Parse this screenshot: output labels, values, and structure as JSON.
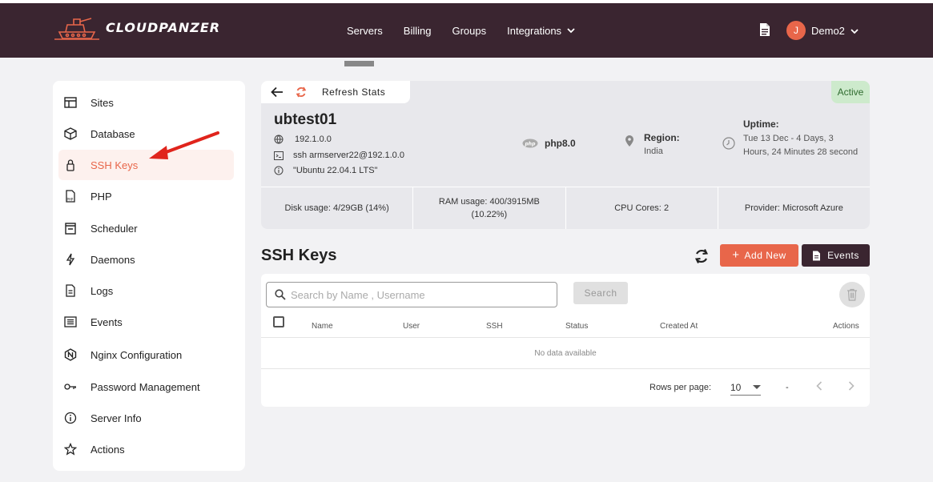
{
  "header": {
    "logo_text": "CLOUDPANZER",
    "nav": [
      {
        "label": "Servers"
      },
      {
        "label": "Billing"
      },
      {
        "label": "Groups"
      },
      {
        "label": "Integrations"
      }
    ],
    "avatar_initial": "J",
    "user_name": "Demo2",
    "colors": {
      "bg": "#3a2530",
      "accent": "#e8664a"
    }
  },
  "sidebar": {
    "items": [
      {
        "label": "Sites",
        "icon": "layout-icon"
      },
      {
        "label": "Database",
        "icon": "cube-icon"
      },
      {
        "label": "SSH Keys",
        "icon": "lock-icon",
        "active": true
      },
      {
        "label": "PHP",
        "icon": "php-file-icon"
      },
      {
        "label": "Scheduler",
        "icon": "calendar-icon"
      },
      {
        "label": "Daemons",
        "icon": "bolt-icon"
      },
      {
        "label": "Logs",
        "icon": "file-icon"
      },
      {
        "label": "Events",
        "icon": "list-icon"
      },
      {
        "label": "Nginx Configuration",
        "icon": "nginx-icon"
      },
      {
        "label": "Password Management",
        "icon": "key-icon"
      },
      {
        "label": "Server Info",
        "icon": "info-icon"
      },
      {
        "label": "Actions",
        "icon": "star-icon"
      }
    ]
  },
  "server": {
    "refresh_label": "Refresh Stats",
    "status": "Active",
    "name": "ubtest01",
    "ip": "192.1.0.0",
    "ssh": "ssh armserver22@192.1.0.0",
    "os": "\"Ubuntu 22.04.1 LTS\"",
    "php": "php8.0",
    "region_label": "Region:",
    "region_value": "India",
    "uptime_label": "Uptime:",
    "uptime_value": "Tue 13 Dec - 4 Days, 3 Hours, 24 Minutes 28 second",
    "stats": {
      "disk_label": "Disk usage:",
      "disk_value": "4/29GB (14%)",
      "ram_label": "RAM usage:",
      "ram_value": "400/3915MB (10.22%)",
      "cpu_label": "CPU Cores:",
      "cpu_value": "2",
      "provider_label": "Provider:",
      "provider_value": "Microsoft Azure"
    }
  },
  "ssh_keys": {
    "title": "SSH Keys",
    "add_button": "Add New",
    "events_button": "Events",
    "search_placeholder": "Search by Name , Username",
    "search_button": "Search",
    "columns": [
      "Name",
      "User",
      "SSH",
      "Status",
      "Created At",
      "Actions"
    ],
    "empty_text": "No data available",
    "rows_per_page_label": "Rows per page:",
    "rows_per_page_value": "10",
    "range_text": "-"
  }
}
